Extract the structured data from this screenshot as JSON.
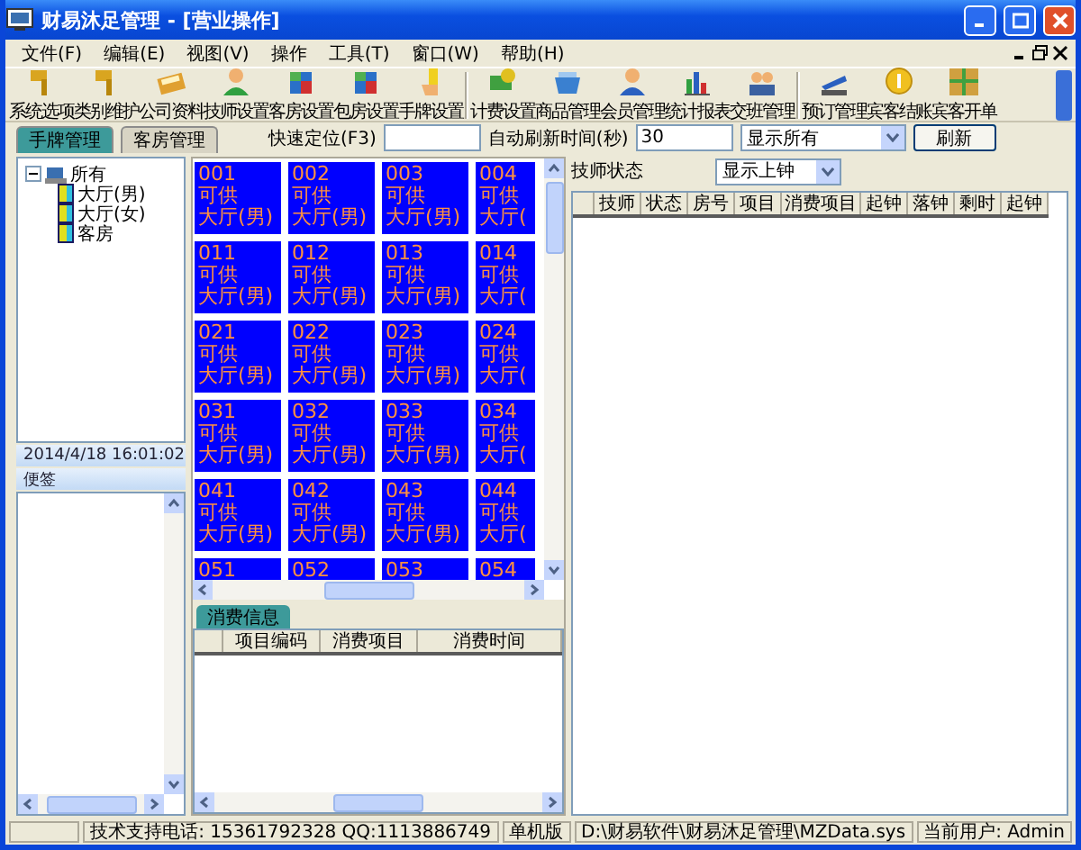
{
  "window": {
    "title": "财易沐足管理 - [营业操作]"
  },
  "menu": [
    "文件(F)",
    "编辑(E)",
    "视图(V)",
    "操作",
    "工具(T)",
    "窗口(W)",
    "帮助(H)"
  ],
  "toolbar": [
    [
      "系统选项",
      "类别维护",
      "公司资料",
      "技师设置",
      "客房设置",
      "包房设置",
      "手牌设置"
    ],
    [
      "计费设置",
      "商品管理",
      "会员管理",
      "统计报表",
      "交班管理"
    ],
    [
      "预订管理",
      "宾客结账",
      "宾客开单"
    ]
  ],
  "tabs": [
    {
      "label": "手牌管理",
      "selected": true
    },
    {
      "label": "客房管理",
      "selected": false
    }
  ],
  "quick_locate": {
    "label": "快速定位(F3)"
  },
  "auto_refresh": {
    "label": "自动刷新时间(秒)",
    "value": "30"
  },
  "display_filter": {
    "value": "显示所有"
  },
  "refresh_button": "刷新",
  "tree": [
    {
      "label": "所有",
      "expanded": true,
      "children": [
        {
          "label": "大厅(男)"
        },
        {
          "label": "大厅(女)"
        },
        {
          "label": "客房"
        }
      ]
    }
  ],
  "datetime": "2014/4/18 16:01:02",
  "notes": {
    "title": "便签"
  },
  "rooms": [
    [
      {
        "number": "001",
        "status": "可供",
        "area": "大厅(男)"
      },
      {
        "number": "002",
        "status": "可供",
        "area": "大厅(男)"
      },
      {
        "number": "003",
        "status": "可供",
        "area": "大厅(男)"
      },
      {
        "number": "004",
        "status": "可供",
        "area": "大厅("
      }
    ],
    [
      {
        "number": "011",
        "status": "可供",
        "area": "大厅(男)"
      },
      {
        "number": "012",
        "status": "可供",
        "area": "大厅(男)"
      },
      {
        "number": "013",
        "status": "可供",
        "area": "大厅(男)"
      },
      {
        "number": "014",
        "status": "可供",
        "area": "大厅("
      }
    ],
    [
      {
        "number": "021",
        "status": "可供",
        "area": "大厅(男)"
      },
      {
        "number": "022",
        "status": "可供",
        "area": "大厅(男)"
      },
      {
        "number": "023",
        "status": "可供",
        "area": "大厅(男)"
      },
      {
        "number": "024",
        "status": "可供",
        "area": "大厅("
      }
    ],
    [
      {
        "number": "031",
        "status": "可供",
        "area": "大厅(男)"
      },
      {
        "number": "032",
        "status": "可供",
        "area": "大厅(男)"
      },
      {
        "number": "033",
        "status": "可供",
        "area": "大厅(男)"
      },
      {
        "number": "034",
        "status": "可供",
        "area": "大厅("
      }
    ],
    [
      {
        "number": "041",
        "status": "可供",
        "area": "大厅(男)"
      },
      {
        "number": "042",
        "status": "可供",
        "area": "大厅(男)"
      },
      {
        "number": "043",
        "status": "可供",
        "area": "大厅(男)"
      },
      {
        "number": "044",
        "status": "可供",
        "area": "大厅("
      }
    ],
    [
      {
        "number": "051"
      },
      {
        "number": "052"
      },
      {
        "number": "053"
      },
      {
        "number": "054"
      }
    ]
  ],
  "consumption": {
    "tab": "消费信息",
    "columns": [
      "项目编码",
      "消费项目",
      "消费时间"
    ]
  },
  "technicians": {
    "label": "技师状态",
    "filter": "显示上钟",
    "columns": [
      "技师",
      "状态",
      "房号",
      "项目",
      "消费项目",
      "起钟",
      "落钟",
      "剩时",
      "起钟"
    ]
  },
  "status_bar": [
    "技术支持电话: 15361792328 QQ:1113886749",
    "单机版",
    "D:\\财易软件\\财易沐足管理\\MZData.sys",
    "当前用户: Admin"
  ]
}
